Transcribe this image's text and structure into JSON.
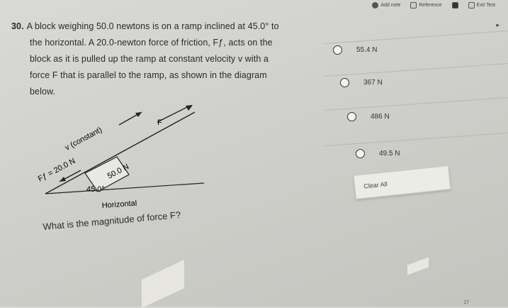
{
  "toolbar": {
    "add_note": "Add note",
    "reference": "Reference",
    "exit_test": "Exit Test"
  },
  "question": {
    "number": "30.",
    "lines": [
      "A block weighing 50.0 newtons is on a ramp inclined at 45.0° to",
      "the horizontal. A 20.0-newton force of friction, Fƒ, acts on the",
      "block as it is pulled up the ramp at constant velocity v with a",
      "force F that is parallel to the ramp, as shown in the diagram",
      "below."
    ],
    "ask": "What is the magnitude of force F?"
  },
  "diagram": {
    "force_label": "F",
    "velocity_label": "v (constant)",
    "block_label": "50.0 N",
    "friction_label": "Fƒ = 20.0 N",
    "angle_label": "45.0°",
    "base_label": "Horizontal"
  },
  "options": [
    {
      "label": "55.4 N"
    },
    {
      "label": "367 N"
    },
    {
      "label": "486 N"
    },
    {
      "label": "49.5 N"
    }
  ],
  "clear_all": "Clear All",
  "page_indicator": "17"
}
